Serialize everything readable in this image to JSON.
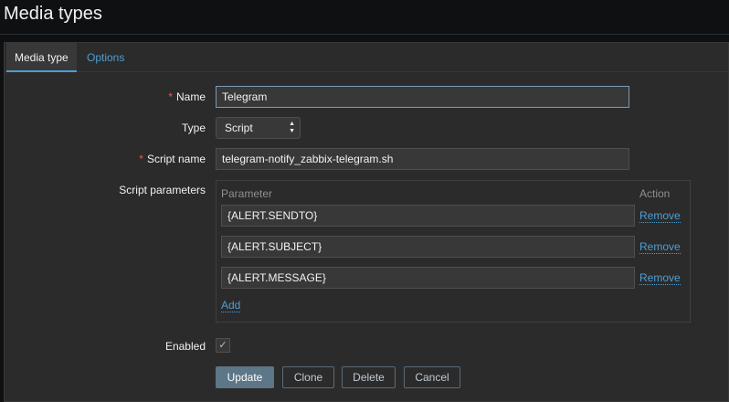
{
  "page": {
    "title": "Media types"
  },
  "tabs": [
    {
      "label": "Media type",
      "active": true
    },
    {
      "label": "Options",
      "active": false
    }
  ],
  "form": {
    "name": {
      "label": "Name",
      "required": "*",
      "value": "Telegram"
    },
    "type": {
      "label": "Type",
      "value": "Script"
    },
    "script_name": {
      "label": "Script name",
      "required": "*",
      "value": "telegram-notify_zabbix-telegram.sh"
    },
    "script_parameters": {
      "label": "Script parameters",
      "col_parameter": "Parameter",
      "col_action": "Action",
      "rows": [
        {
          "value": "{ALERT.SENDTO}",
          "action": "Remove"
        },
        {
          "value": "{ALERT.SUBJECT}",
          "action": "Remove"
        },
        {
          "value": "{ALERT.MESSAGE}",
          "action": "Remove"
        }
      ],
      "add_label": "Add"
    },
    "enabled": {
      "label": "Enabled",
      "checked": true,
      "check_glyph": "✓"
    }
  },
  "buttons": {
    "update": "Update",
    "clone": "Clone",
    "delete": "Delete",
    "cancel": "Cancel"
  },
  "icons": {
    "select_arrows": "▲▼",
    "check": "check-icon"
  },
  "colors": {
    "accent": "#4f9ed4",
    "required": "#e45959",
    "primary_button": "#5d7688"
  }
}
